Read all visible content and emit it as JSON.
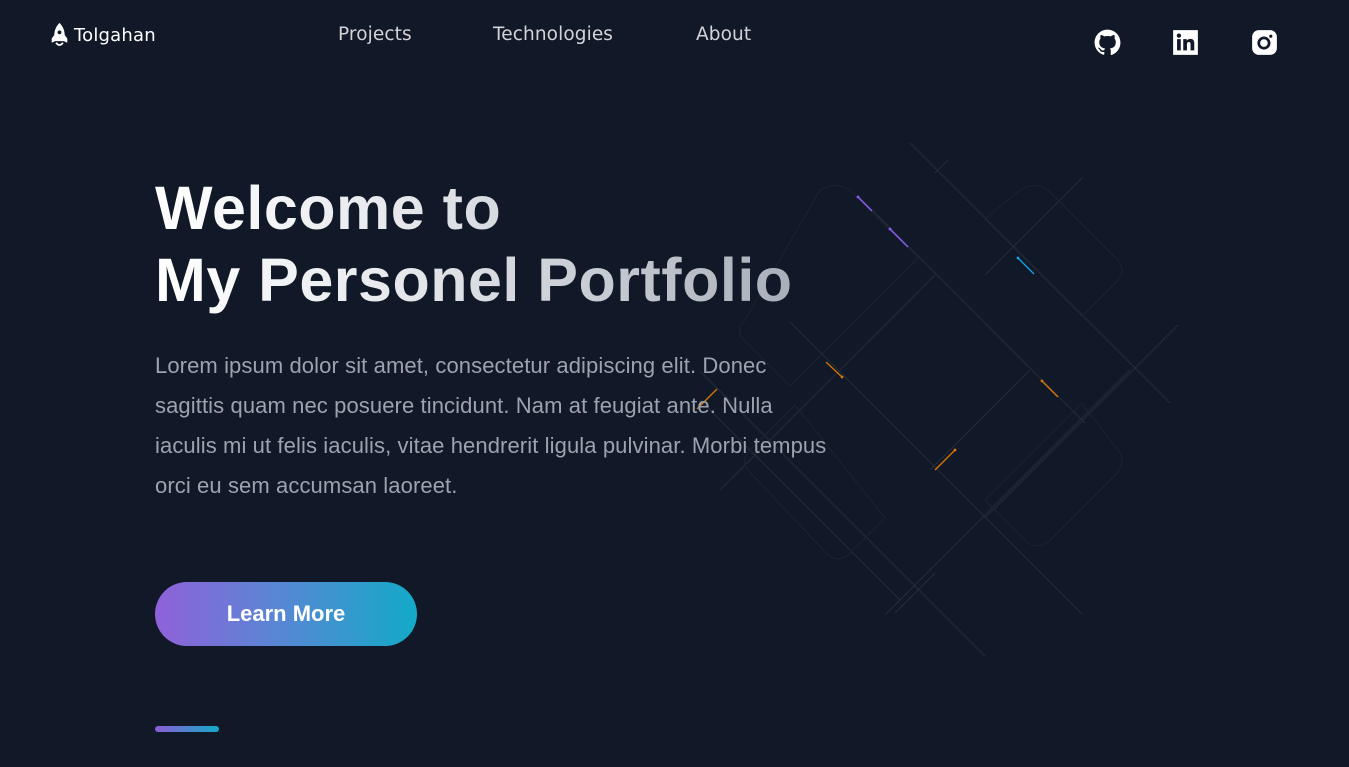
{
  "nav": {
    "brand": {
      "label": "Tolgahan",
      "icon": "rocket-icon"
    },
    "links": [
      {
        "label": "Projects"
      },
      {
        "label": "Technologies"
      },
      {
        "label": "About"
      }
    ],
    "socials": [
      {
        "name": "GitHub",
        "icon": "github-icon"
      },
      {
        "name": "LinkedIn",
        "icon": "linkedin-icon"
      },
      {
        "name": "Instagram",
        "icon": "instagram-icon"
      }
    ]
  },
  "hero": {
    "title_line1": "Welcome to",
    "title_line2": "My Personel Portfolio",
    "description": "Lorem ipsum dolor sit amet, consectetur adipiscing elit. Donec sagittis quam nec posuere tincidunt. Nam at feugiat ante. Nulla iaculis mi ut felis iaculis, vitae hendrerit ligula pulvinar. Morbi tempus orci eu sem accumsan laoreet.",
    "cta_label": "Learn More"
  },
  "colors": {
    "background": "#111827",
    "gradient_start": "#9061d9",
    "gradient_end": "#13aac7",
    "text_muted": "#9ca3af",
    "pattern_line": "#2a313d",
    "spark_purple": "#8b5cf6",
    "spark_cyan": "#0ea5e9",
    "spark_orange": "#d97706"
  }
}
